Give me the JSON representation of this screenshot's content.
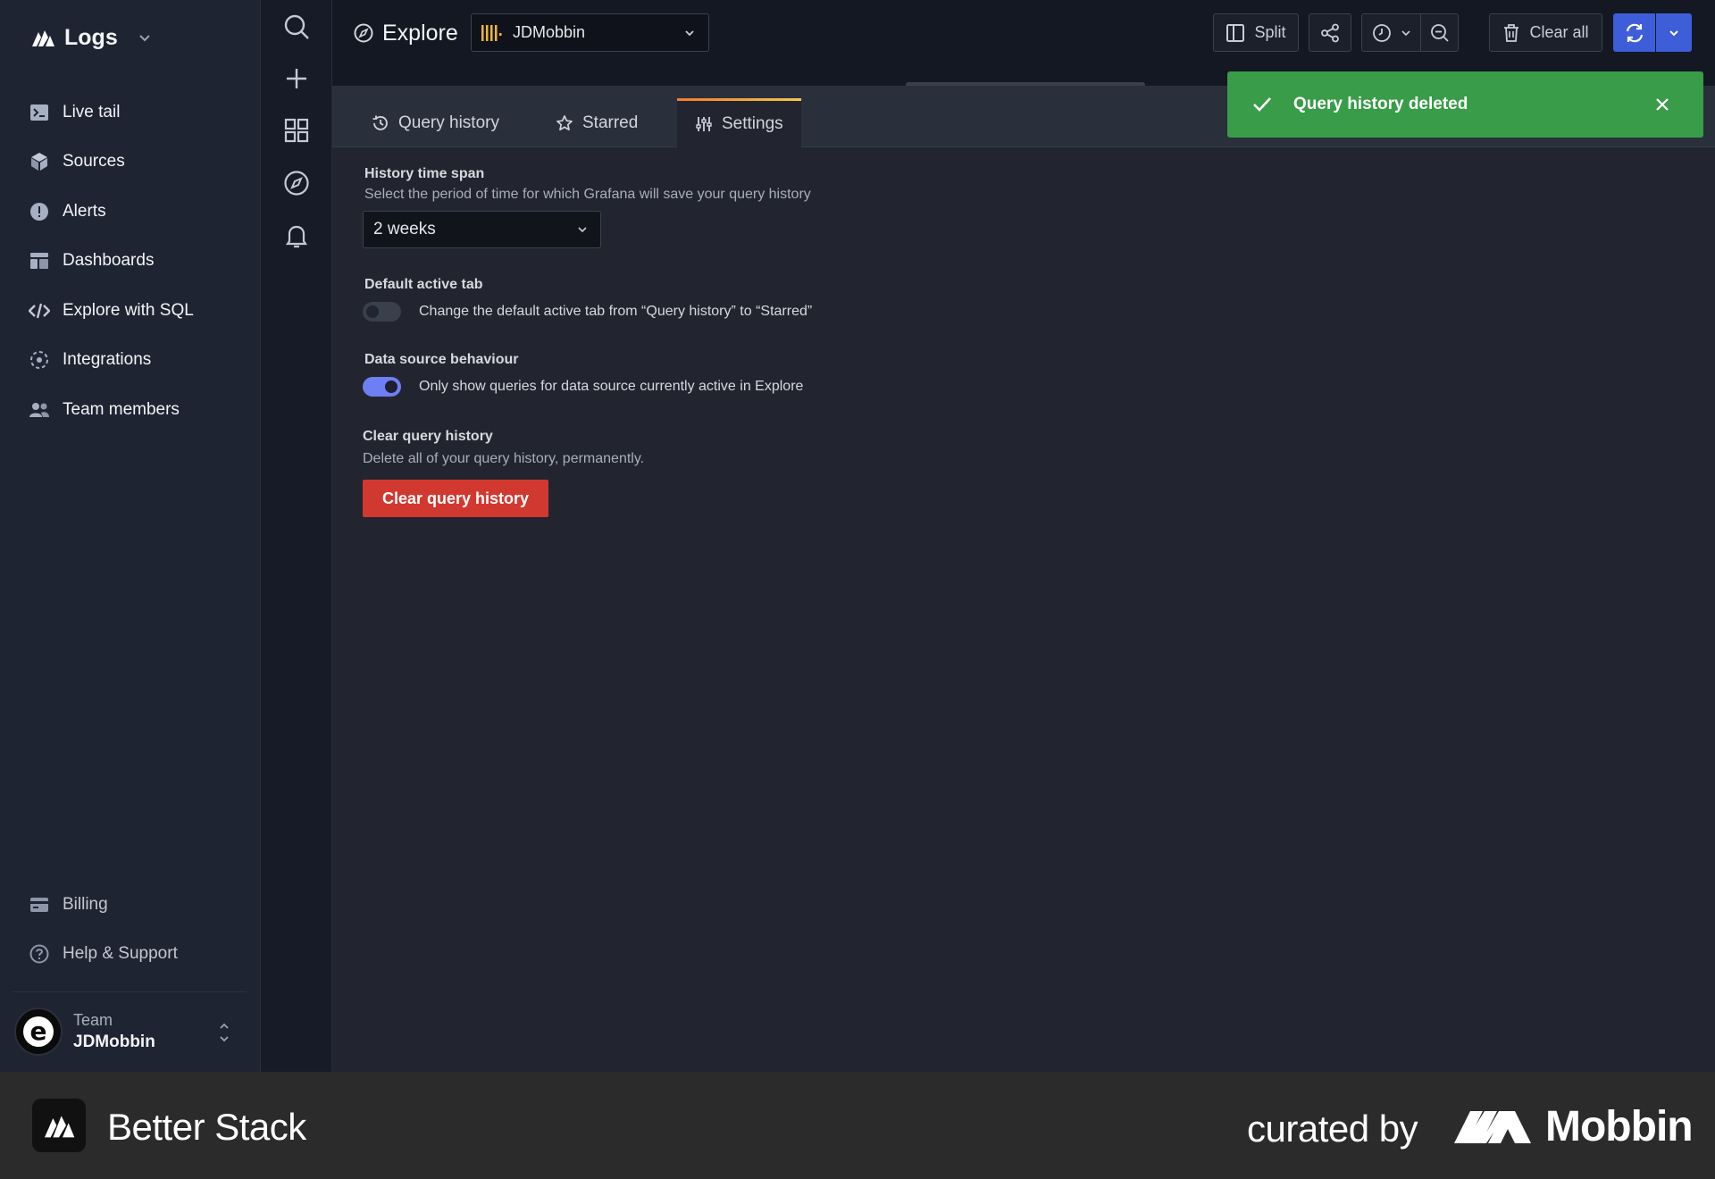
{
  "sidebar": {
    "brand": "Logs",
    "items": [
      {
        "label": "Live tail",
        "icon": "terminal-icon"
      },
      {
        "label": "Sources",
        "icon": "cube-icon"
      },
      {
        "label": "Alerts",
        "icon": "alert-icon"
      },
      {
        "label": "Dashboards",
        "icon": "dashboard-icon"
      },
      {
        "label": "Explore with SQL",
        "icon": "code-icon"
      },
      {
        "label": "Integrations",
        "icon": "integrations-icon"
      },
      {
        "label": "Team members",
        "icon": "team-icon"
      }
    ],
    "bottom_items": [
      {
        "label": "Billing",
        "icon": "credit-card-icon"
      },
      {
        "label": "Help & Support",
        "icon": "help-circle-icon"
      }
    ],
    "team": {
      "label": "Team",
      "name": "JDMobbin"
    }
  },
  "rail": [
    "search-icon",
    "plus-icon",
    "grid-icon",
    "compass-icon",
    "bell-icon"
  ],
  "topbar": {
    "title": "Explore",
    "datasource": "JDMobbin",
    "split_label": "Split",
    "clear_all_label": "Clear all"
  },
  "tabs": [
    {
      "label": "Query history",
      "icon": "history-icon"
    },
    {
      "label": "Starred",
      "icon": "star-icon"
    },
    {
      "label": "Settings",
      "icon": "sliders-icon",
      "active": true
    }
  ],
  "settings": {
    "time_span": {
      "title": "History time span",
      "desc": "Select the period of time for which Grafana will save your query history",
      "value": "2 weeks"
    },
    "default_tab": {
      "title": "Default active tab",
      "label": "Change the default active tab from “Query history” to “Starred”",
      "enabled": false
    },
    "ds_behaviour": {
      "title": "Data source behaviour",
      "label": "Only show queries for data source currently active in Explore",
      "enabled": true
    },
    "clear": {
      "title": "Clear query history",
      "desc": "Delete all of your query history, permanently.",
      "button": "Clear query history"
    }
  },
  "toast": {
    "message": "Query history deleted"
  },
  "footer": {
    "brand": "Better Stack",
    "curated_by": "curated by",
    "mobbin": "Mobbin"
  },
  "colors": {
    "accent": "#3d5ed8",
    "toast": "#389c48",
    "danger": "#d1382f",
    "toggle_on": "#6e7ff3"
  }
}
